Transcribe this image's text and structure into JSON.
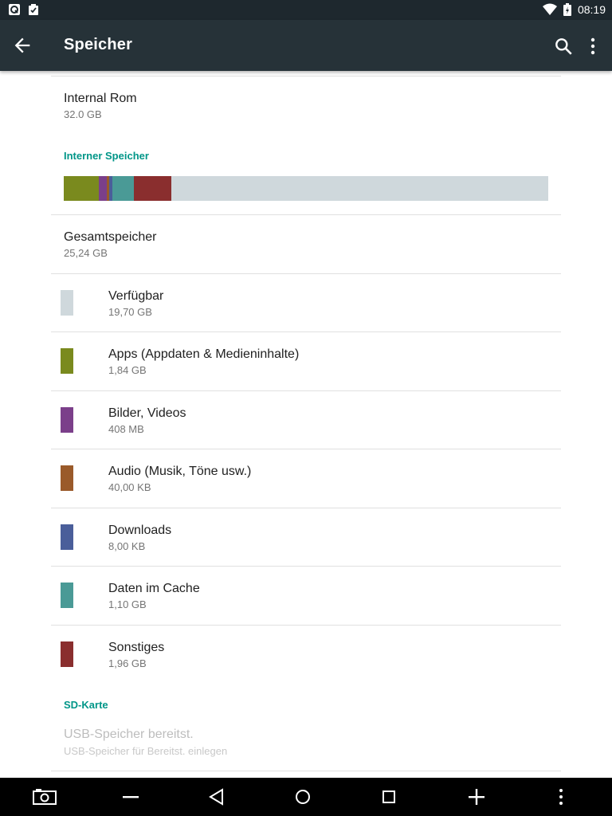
{
  "status_bar": {
    "time": "08:19"
  },
  "app_bar": {
    "title": "Speicher"
  },
  "internal_rom": {
    "title": "Internal Rom",
    "value": "32.0 GB"
  },
  "internal_storage": {
    "header": "Interner Speicher",
    "usage_bar_fractions": [
      {
        "name": "apps",
        "fraction": 0.0729,
        "color": "#7a8a1e"
      },
      {
        "name": "pictures",
        "fraction": 0.0162,
        "color": "#7b3f8a"
      },
      {
        "name": "audio",
        "fraction": 0.005,
        "color": "#9a5a2a"
      },
      {
        "name": "downloads",
        "fraction": 0.007,
        "color": "#4a5e9a"
      },
      {
        "name": "cache",
        "fraction": 0.0436,
        "color": "#4a9a96"
      },
      {
        "name": "misc",
        "fraction": 0.0777,
        "color": "#8a2e2e"
      },
      {
        "name": "free",
        "fraction": 0.7776,
        "color": "#cfd8dc"
      }
    ],
    "total": {
      "title": "Gesamtspeicher",
      "value": "25,24 GB"
    },
    "items": [
      {
        "label": "Verfügbar",
        "value": "19,70 GB",
        "color": "#cfd8dc"
      },
      {
        "label": "Apps (Appdaten & Medieninhalte)",
        "value": "1,84 GB",
        "color": "#7a8a1e"
      },
      {
        "label": "Bilder, Videos",
        "value": "408 MB",
        "color": "#7b3f8a"
      },
      {
        "label": "Audio (Musik, Töne usw.)",
        "value": "40,00 KB",
        "color": "#9a5a2a"
      },
      {
        "label": "Downloads",
        "value": "8,00 KB",
        "color": "#4a5e9a"
      },
      {
        "label": "Daten im Cache",
        "value": "1,10 GB",
        "color": "#4a9a96"
      },
      {
        "label": "Sonstiges",
        "value": "1,96 GB",
        "color": "#8a2e2e"
      }
    ]
  },
  "sd_card": {
    "header": "SD-Karte",
    "title": "USB-Speicher bereitst.",
    "subtitle": "USB-Speicher für Bereitst. einlegen"
  },
  "colors": {
    "accent": "#009688",
    "app_bar": "#263238",
    "status_bar": "#1e282e"
  }
}
